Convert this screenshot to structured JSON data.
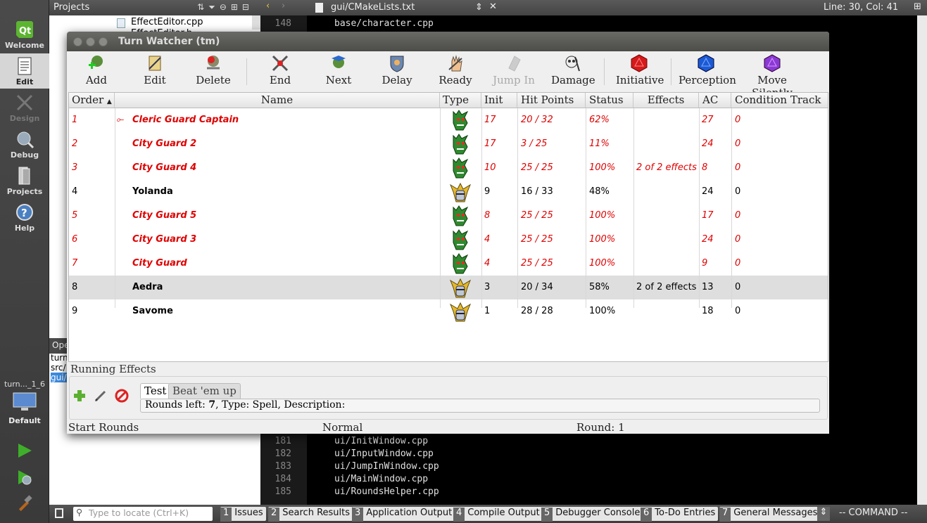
{
  "modebar": {
    "items": [
      {
        "label": "Welcome",
        "icon": "qt-logo-icon"
      },
      {
        "label": "Edit",
        "icon": "edit-document-icon"
      },
      {
        "label": "Design",
        "icon": "design-icon"
      },
      {
        "label": "Debug",
        "icon": "debug-icon"
      },
      {
        "label": "Projects",
        "icon": "projects-icon"
      },
      {
        "label": "Help",
        "icon": "help-icon"
      }
    ],
    "target_label": "turn..._1_6",
    "target_config": "Default"
  },
  "projects_pane": {
    "title": "Projects",
    "files": [
      "EffectEditor.cpp",
      "EffectEditor.h"
    ],
    "open_docs_title": "Ope",
    "open_docs": [
      "turn",
      "src/",
      "gui/"
    ]
  },
  "editor": {
    "file": "gui/CMakeLists.txt",
    "position": "Line: 30, Col: 41",
    "top_line": {
      "num": "148",
      "text": "base/character.cpp"
    },
    "lines": [
      {
        "num": "181",
        "text": "ui/InitWindow.cpp"
      },
      {
        "num": "182",
        "text": "ui/InputWindow.cpp"
      },
      {
        "num": "183",
        "text": "ui/JumpInWindow.cpp"
      },
      {
        "num": "184",
        "text": "ui/MainWindow.cpp"
      },
      {
        "num": "185",
        "text": "ui/RoundsHelper.cpp"
      }
    ]
  },
  "bottombar": {
    "locate_placeholder": "Type to locate (Ctrl+K)",
    "tabs": [
      {
        "n": "1",
        "label": "Issues"
      },
      {
        "n": "2",
        "label": "Search Results"
      },
      {
        "n": "3",
        "label": "Application Output"
      },
      {
        "n": "4",
        "label": "Compile Output"
      },
      {
        "n": "5",
        "label": "Debugger Console"
      },
      {
        "n": "6",
        "label": "To-Do Entries"
      },
      {
        "n": "7",
        "label": "General Messages"
      }
    ],
    "mode": "-- COMMAND --"
  },
  "turn_watcher": {
    "title": "Turn Watcher (tm)",
    "toolbar": [
      "Add",
      "Edit",
      "Delete",
      "End",
      "Next",
      "Delay",
      "Ready",
      "Jump In",
      "Damage",
      "Initiative",
      "Perception",
      "Move Silently"
    ],
    "columns": [
      "Order",
      "Name",
      "Type",
      "Init",
      "Hit Points",
      "Status",
      "Effects",
      "AC",
      "Condition Track"
    ],
    "rows": [
      {
        "order": "1",
        "marker": "⟜",
        "name": "Cleric Guard Captain",
        "init": "17",
        "hp": "20 / 32",
        "status": "62%",
        "effects": "",
        "ac": "27",
        "ct": "0",
        "kind": "enemy"
      },
      {
        "order": "2",
        "marker": "",
        "name": "City Guard 2",
        "init": "17",
        "hp": "3 / 25",
        "status": "11%",
        "effects": "",
        "ac": "24",
        "ct": "0",
        "kind": "enemy"
      },
      {
        "order": "3",
        "marker": "",
        "name": "City Guard 4",
        "init": "10",
        "hp": "25 / 25",
        "status": "100%",
        "effects": "2 of 2 effects",
        "ac": "8",
        "ct": "0",
        "kind": "enemy"
      },
      {
        "order": "4",
        "marker": "",
        "name": "Yolanda",
        "init": "9",
        "hp": "16 / 33",
        "status": "48%",
        "effects": "",
        "ac": "24",
        "ct": "0",
        "kind": "friend"
      },
      {
        "order": "5",
        "marker": "",
        "name": "City Guard 5",
        "init": "8",
        "hp": "25 / 25",
        "status": "100%",
        "effects": "",
        "ac": "17",
        "ct": "0",
        "kind": "enemy"
      },
      {
        "order": "6",
        "marker": "",
        "name": "City Guard 3",
        "init": "4",
        "hp": "25 / 25",
        "status": "100%",
        "effects": "",
        "ac": "24",
        "ct": "0",
        "kind": "enemy"
      },
      {
        "order": "7",
        "marker": "",
        "name": "City Guard",
        "init": "4",
        "hp": "25 / 25",
        "status": "100%",
        "effects": "",
        "ac": "9",
        "ct": "0",
        "kind": "enemy"
      },
      {
        "order": "8",
        "marker": "",
        "name": "Aedra",
        "init": "3",
        "hp": "20 / 34",
        "status": "58%",
        "effects": "2 of 2 effects",
        "ac": "13",
        "ct": "0",
        "kind": "friend"
      },
      {
        "order": "9",
        "marker": "",
        "name": "Savome",
        "init": "1",
        "hp": "28 / 28",
        "status": "100%",
        "effects": "",
        "ac": "18",
        "ct": "0",
        "kind": "friend"
      }
    ],
    "running_effects": {
      "label": "Running Effects",
      "tabs": [
        "Test",
        "Beat 'em up"
      ],
      "desc_prefix": "Rounds left: ",
      "rounds": "7",
      "desc_mid": ", Type: Spell, Description:"
    },
    "status": {
      "left": "Start Rounds",
      "mid": "Normal",
      "round_label": "Round: ",
      "round": "1"
    }
  }
}
